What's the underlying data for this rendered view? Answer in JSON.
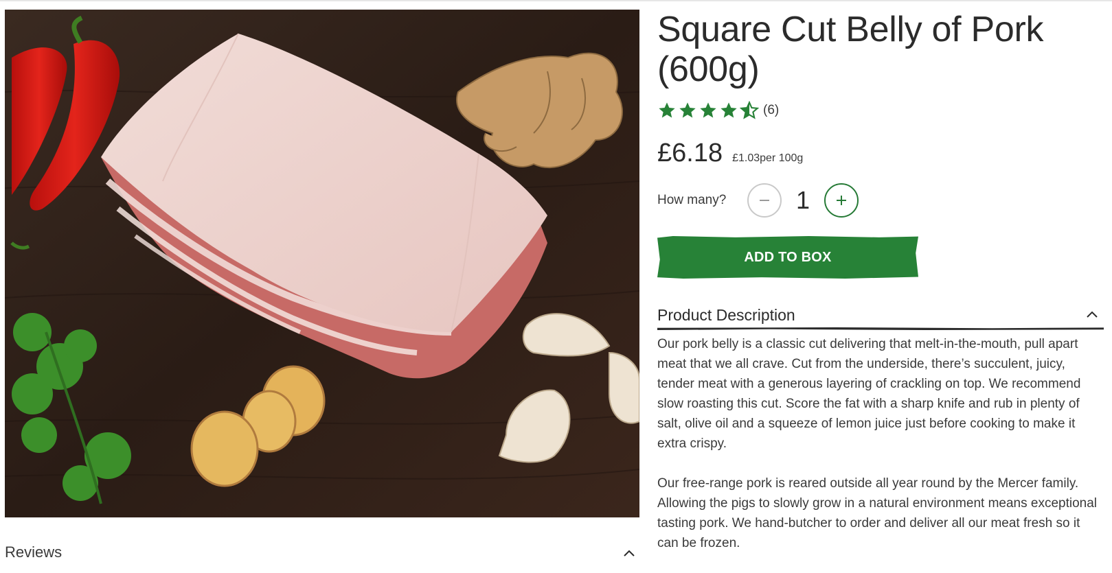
{
  "product": {
    "title": "Square Cut Belly of Pork (600g)",
    "rating": {
      "stars": 4.5,
      "max": 5,
      "count_label": "(6)"
    },
    "price": "£6.18",
    "unit_price": "£1.03per 100g",
    "quantity": {
      "label": "How many?",
      "value": "1",
      "decrement_icon": "minus-icon",
      "increment_icon": "plus-icon"
    },
    "add_button_label": "ADD TO BOX",
    "colors": {
      "accent_green": "#278237",
      "text": "#2b2b2b"
    }
  },
  "description": {
    "title": "Product Description",
    "paragraphs": [
      "Our pork belly is a classic cut delivering that melt-in-the-mouth, pull apart meat that we all crave. Cut from the underside, there’s succulent, juicy, tender meat with a generous layering of crackling on top. We recommend slow roasting this cut. Score the fat with a sharp knife and rub in plenty of salt, olive oil and a squeeze of lemon juice just before cooking to make it extra crispy.",
      "Our free-range pork is reared outside all year round by the Mercer family. Allowing the pigs to slowly grow in a natural environment means exceptional tasting pork. We hand-butcher to order and deliver all our meat fresh so it can be frozen."
    ]
  },
  "reviews": {
    "title": "Reviews"
  }
}
